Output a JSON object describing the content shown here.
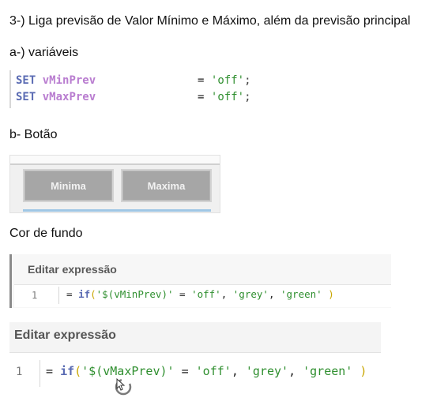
{
  "heading": "3-) Liga previsão de Valor Mínimo e Máximo, além da previsão principal",
  "section_a": "a-) variáveis",
  "code_lines": [
    {
      "kw": "SET",
      "var": "vMinPrev",
      "eq": "=",
      "val": "'off'",
      "end": ";"
    },
    {
      "kw": "SET",
      "var": "vMaxPrev",
      "eq": "=",
      "val": "'off'",
      "end": ";"
    }
  ],
  "section_b": "b- Botão",
  "buttons": {
    "min_label": "Minima",
    "max_label": "Maxima"
  },
  "section_bg": "Cor de fundo",
  "editor1": {
    "title": "Editar expressão",
    "line_number": "1",
    "eq": "=",
    "fn": "if",
    "open": "(",
    "arg1": "'$(vMinPrev)'",
    "mid1": " = ",
    "arg2": "'off'",
    "sep1": ", ",
    "arg3": "'grey'",
    "sep2": ", ",
    "arg4": "'green'",
    "close": " )"
  },
  "editor2": {
    "title": "Editar expressão",
    "line_number": "1",
    "eq": "=",
    "fn": "if",
    "open": "(",
    "arg1": "'$(vMaxPrev)'",
    "mid1": " = ",
    "arg2": "'off'",
    "sep1": ", ",
    "arg3": "'grey'",
    "sep2": ", ",
    "arg4": "'green'",
    "close": " )"
  },
  "colors": {
    "keyword": "#5a6bb3",
    "variable": "#b97dd0",
    "string": "#2f8f2f",
    "paren": "#c9a600",
    "button": "#a6a6a6"
  },
  "icons": {
    "cursor": "busy-cursor-icon"
  }
}
